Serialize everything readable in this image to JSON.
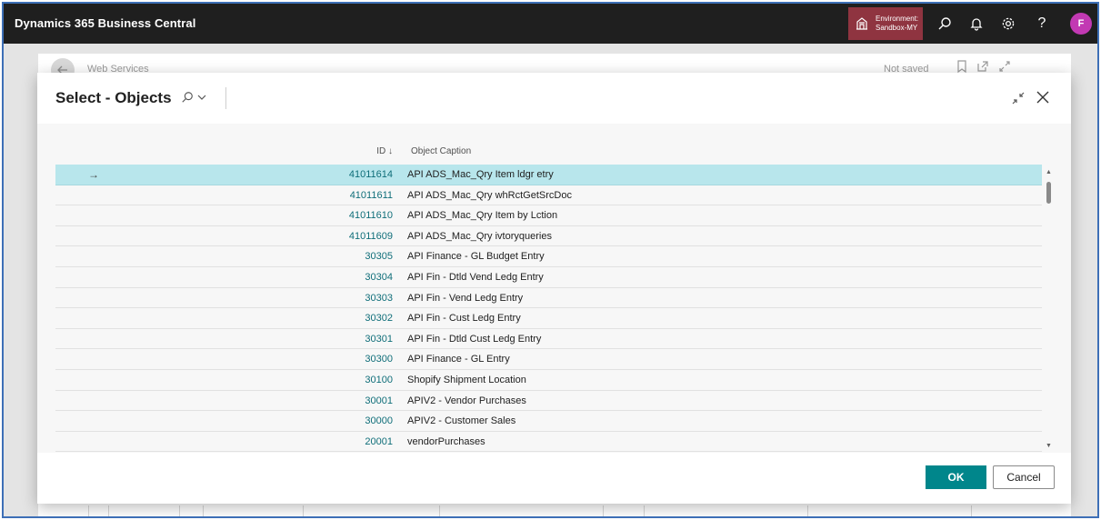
{
  "app": {
    "title": "Dynamics 365 Business Central",
    "environment_label": "Environment:",
    "environment_name": "Sandbox-MY",
    "avatar_initial": "F",
    "help_glyph": "?",
    "accent_color": "#00868b",
    "env_color": "#8f3440"
  },
  "background_page": {
    "title": "Web Services",
    "status": "Not saved"
  },
  "dialog": {
    "title": "Select - Objects",
    "columns": {
      "id": "ID",
      "caption": "Object Caption"
    },
    "sort_indicator": "↓",
    "rows": [
      {
        "id": "41011614",
        "caption": "API ADS_Mac_Qry Item ldgr etry",
        "selected": true
      },
      {
        "id": "41011611",
        "caption": "API ADS_Mac_Qry whRctGetSrcDoc"
      },
      {
        "id": "41011610",
        "caption": "API ADS_Mac_Qry Item by Lction"
      },
      {
        "id": "41011609",
        "caption": "API ADS_Mac_Qry ivtoryqueries"
      },
      {
        "id": "30305",
        "caption": "API Finance - GL Budget Entry"
      },
      {
        "id": "30304",
        "caption": "API Fin - Dtld Vend Ledg Entry"
      },
      {
        "id": "30303",
        "caption": "API Fin - Vend Ledg Entry"
      },
      {
        "id": "30302",
        "caption": "API Fin - Cust Ledg Entry"
      },
      {
        "id": "30301",
        "caption": "API Fin - Dtld Cust Ledg Entry"
      },
      {
        "id": "30300",
        "caption": "API Finance - GL Entry"
      },
      {
        "id": "30100",
        "caption": "Shopify Shipment Location"
      },
      {
        "id": "30001",
        "caption": "APIV2 - Vendor Purchases"
      },
      {
        "id": "30000",
        "caption": "APIV2 - Customer Sales"
      },
      {
        "id": "20001",
        "caption": "vendorPurchases"
      }
    ],
    "ok_label": "OK",
    "cancel_label": "Cancel"
  },
  "icons": {
    "env": "building-icon",
    "search": "search-icon",
    "bell": "bell-icon",
    "settings": "gear-icon",
    "help": "help-icon",
    "back": "back-arrow-icon",
    "bookmark": "bookmark-icon",
    "open_new": "open-new-icon",
    "collapse": "collapse-icon",
    "close": "close-icon",
    "row_arrow": "row-arrow-icon"
  }
}
